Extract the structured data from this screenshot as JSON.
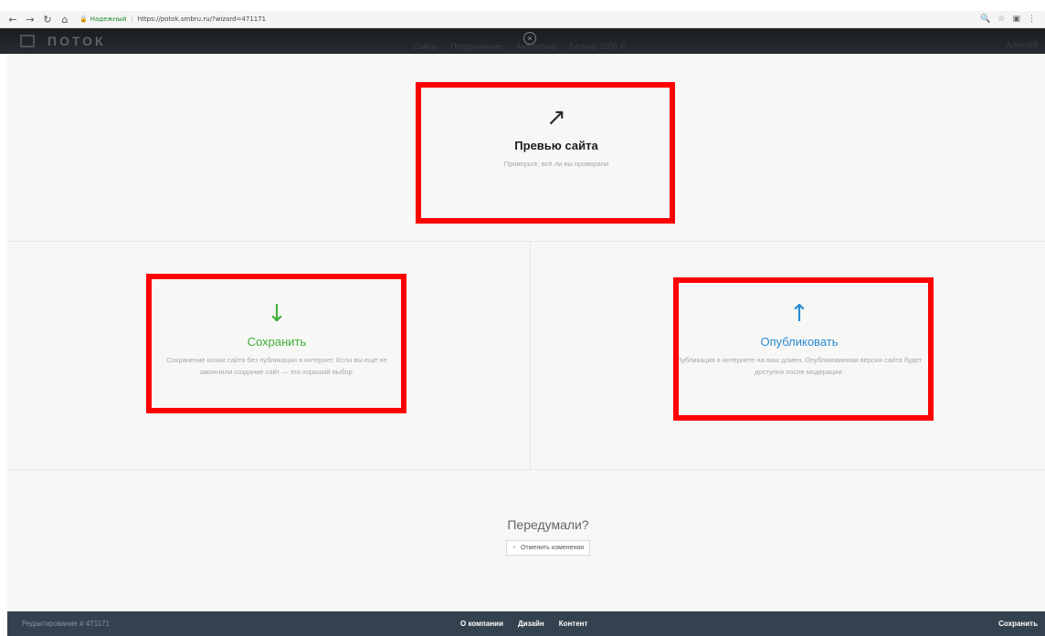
{
  "browser": {
    "back_glyph": "←",
    "forward_glyph": "→",
    "reload_glyph": "↻",
    "home_glyph": "⌂",
    "lock_glyph": "🔒",
    "secure_label": "Надежный",
    "url": "https://potok.smbru.ru/?wizard=471171",
    "zoom_glyph": "🔍",
    "bookmark_glyph": "☆"
  },
  "site_header": {
    "logo_text": "ПОТОК",
    "nav": [
      "Сайты",
      "Продвижение",
      "Аналитика",
      "Баланс 1000 Р"
    ],
    "close_glyph": "×",
    "user": "Алексей"
  },
  "options": {
    "preview": {
      "icon_glyph": "↗",
      "title": "Превью сайта",
      "description": "Проверьте, всё ли вы проверили"
    },
    "save": {
      "icon_glyph": "↓",
      "title": "Сохранить",
      "description": "Сохранение копии сайта без публикации в интернет. Если вы ещё не закончили создание сайт — это хороший выбор."
    },
    "publish": {
      "icon_glyph": "↑",
      "title": "Опубликовать",
      "description": "Публикация в интернете на ваш домен. Опубликованная версия сайта будет доступна после модерации."
    }
  },
  "cancel": {
    "title": "Передумали?",
    "x_glyph": "×",
    "button_label": "Отменить изменения"
  },
  "footer": {
    "editing": "Редактирование # 471171",
    "nav": [
      "О компании",
      "Дизайн",
      "Контент"
    ],
    "save": "Сохранить"
  },
  "colors": {
    "highlight": "#ff0000",
    "save_green": "#3fae3a",
    "publish_blue": "#2a8ad4",
    "footer_bg": "#34414f",
    "header_bg": "#1f2427"
  }
}
